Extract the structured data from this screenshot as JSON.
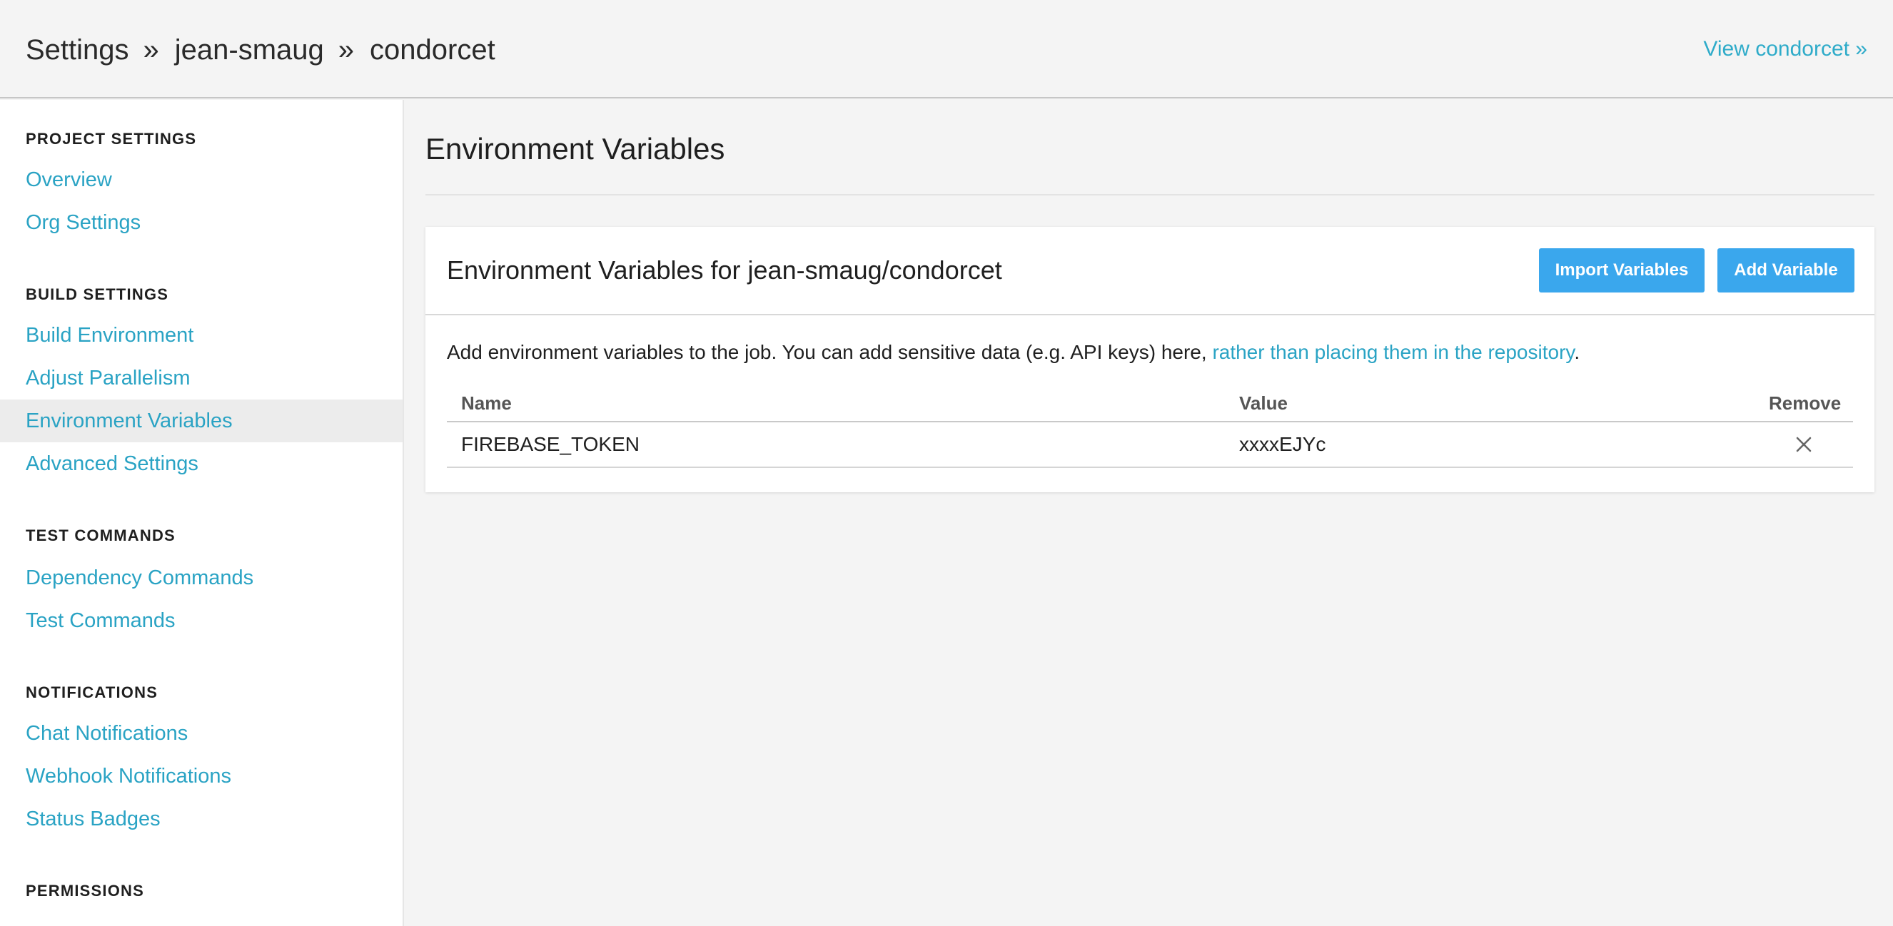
{
  "header": {
    "breadcrumb": [
      "Settings",
      "jean-smaug",
      "condorcet"
    ],
    "separator": "»",
    "view_link": "View condorcet »"
  },
  "sidebar": {
    "sections": [
      {
        "heading": "PROJECT SETTINGS",
        "items": [
          "Overview",
          "Org Settings"
        ]
      },
      {
        "heading": "BUILD SETTINGS",
        "items": [
          "Build Environment",
          "Adjust Parallelism",
          "Environment Variables",
          "Advanced Settings"
        ]
      },
      {
        "heading": "TEST COMMANDS",
        "items": [
          "Dependency Commands",
          "Test Commands"
        ]
      },
      {
        "heading": "NOTIFICATIONS",
        "items": [
          "Chat Notifications",
          "Webhook Notifications",
          "Status Badges"
        ]
      },
      {
        "heading": "PERMISSIONS",
        "items": []
      }
    ],
    "active_item": "Environment Variables"
  },
  "main": {
    "title": "Environment Variables",
    "card": {
      "title": "Environment Variables for jean-smaug/condorcet",
      "import_button": "Import Variables",
      "add_button": "Add Variable",
      "description_prefix": "Add environment variables to the job. You can add sensitive data (e.g. API keys) here, ",
      "description_link": "rather than placing them in the repository",
      "description_suffix": ".",
      "table": {
        "columns": [
          "Name",
          "Value",
          "Remove"
        ],
        "rows": [
          {
            "name": "FIREBASE_TOKEN",
            "value": "xxxxEJYc",
            "remove_icon": "close-icon"
          }
        ]
      }
    }
  },
  "colors": {
    "link": "#2aa3c4",
    "button": "#3aa7ed",
    "active_item_bg": "#ececec"
  }
}
